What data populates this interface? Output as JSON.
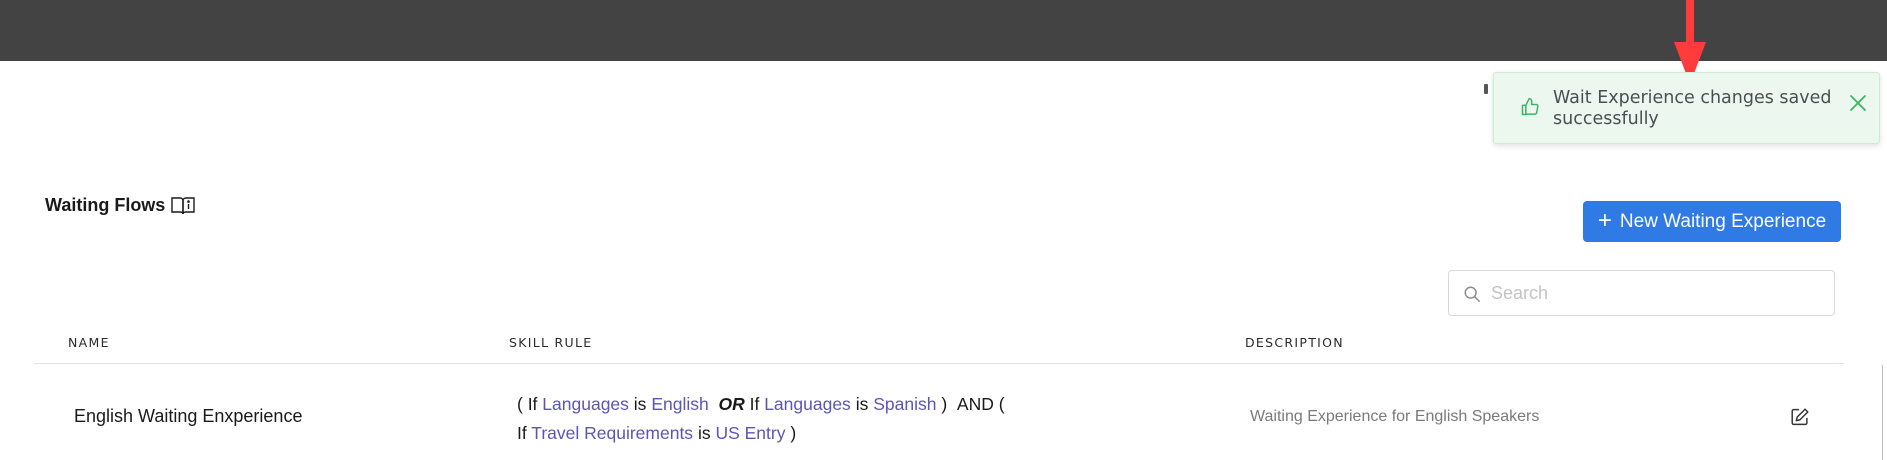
{
  "toast": {
    "message": "Wait Experience changes saved successfully",
    "accent": "#3cb563",
    "background": "#ecf8ef"
  },
  "page": {
    "title": "Waiting Flows",
    "title_icon": "book-info-icon"
  },
  "toolbar": {
    "new_button_label": "New Waiting Experience",
    "button_color": "#2f7ae5"
  },
  "search": {
    "placeholder": "Search",
    "value": ""
  },
  "table": {
    "columns": [
      "NAME",
      "SKILL RULE",
      "DESCRIPTION"
    ],
    "rows": [
      {
        "name": "English Waiting Enxperience",
        "description": "Waiting Experience for English Speakers",
        "rule": {
          "open1": "( If",
          "attr1": "Languages",
          "is1": "is",
          "val1": "English",
          "or": "OR",
          "if2": "If",
          "attr2": "Languages",
          "is2": "is",
          "val2": "Spanish",
          "close1": ")",
          "and_open": "AND (",
          "if3": "If",
          "attr3": "Travel Requirements",
          "is3": "is",
          "val3": "US Entry",
          "close2": ")"
        }
      }
    ]
  },
  "annotation": {
    "arrow_color": "#ff3b3b"
  }
}
